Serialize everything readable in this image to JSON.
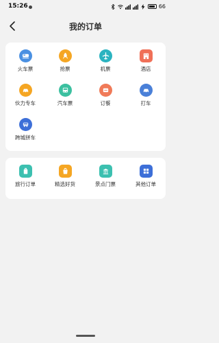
{
  "status_bar": {
    "time": "15:26",
    "battery": "66"
  },
  "header": {
    "title": "我的订单"
  },
  "section1": {
    "items": [
      {
        "label": "火车票",
        "icon": "train-icon",
        "color": "#4a90e2"
      },
      {
        "label": "抢票",
        "icon": "rocket-icon",
        "color": "#f5a623"
      },
      {
        "label": "机票",
        "icon": "plane-icon",
        "color": "#2bb3c0"
      },
      {
        "label": "酒店",
        "icon": "hotel-icon",
        "color": "#f07058"
      },
      {
        "label": "伙力专车",
        "icon": "car-icon",
        "color": "#f5a623"
      },
      {
        "label": "汽车票",
        "icon": "bus-icon",
        "color": "#3cc0a0"
      },
      {
        "label": "订餐",
        "icon": "meal-icon",
        "color": "#f07a58"
      },
      {
        "label": "打车",
        "icon": "taxi-icon",
        "color": "#4a80d8"
      },
      {
        "label": "跨城拼车",
        "icon": "intercity-car-icon",
        "color": "#3d6fd8"
      }
    ]
  },
  "section2": {
    "items": [
      {
        "label": "旅行订单",
        "icon": "luggage-icon",
        "color": "#3cc0b0"
      },
      {
        "label": "精选好货",
        "icon": "shopping-bag-icon",
        "color": "#f5a623"
      },
      {
        "label": "景点门票",
        "icon": "temple-icon",
        "color": "#3cc0b0"
      },
      {
        "label": "其他订单",
        "icon": "grid-icon",
        "color": "#3d6fd8"
      }
    ]
  }
}
